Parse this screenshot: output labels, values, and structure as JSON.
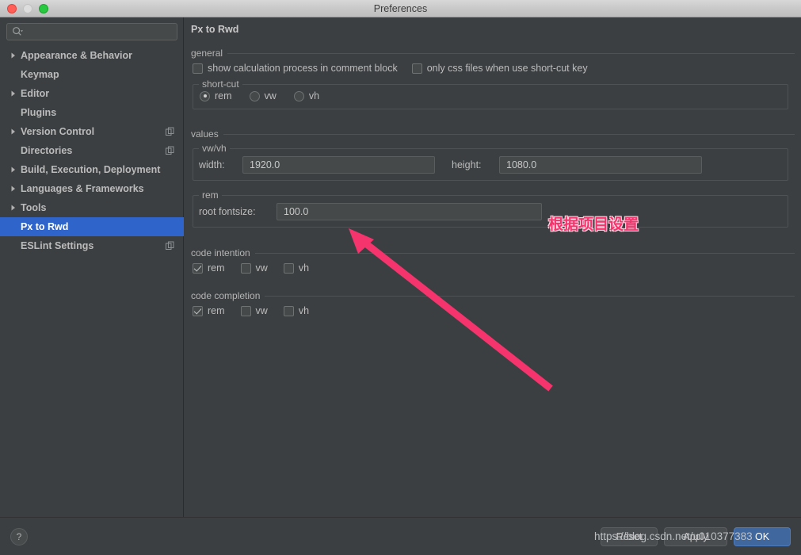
{
  "window": {
    "title": "Preferences",
    "traffic_lights": [
      "close-red",
      "minimize-gray",
      "zoom-green"
    ]
  },
  "sidebar": {
    "search": {
      "value": "",
      "placeholder": ""
    },
    "items": [
      {
        "label": "Appearance & Behavior",
        "expandable": true,
        "selected": false,
        "copy_icon": false
      },
      {
        "label": "Keymap",
        "expandable": false,
        "selected": false,
        "copy_icon": false
      },
      {
        "label": "Editor",
        "expandable": true,
        "selected": false,
        "copy_icon": false
      },
      {
        "label": "Plugins",
        "expandable": false,
        "selected": false,
        "copy_icon": false
      },
      {
        "label": "Version Control",
        "expandable": true,
        "selected": false,
        "copy_icon": true
      },
      {
        "label": "Directories",
        "expandable": false,
        "selected": false,
        "copy_icon": true
      },
      {
        "label": "Build, Execution, Deployment",
        "expandable": true,
        "selected": false,
        "copy_icon": false
      },
      {
        "label": "Languages & Frameworks",
        "expandable": true,
        "selected": false,
        "copy_icon": false
      },
      {
        "label": "Tools",
        "expandable": true,
        "selected": false,
        "copy_icon": false
      },
      {
        "label": "Px to Rwd",
        "expandable": false,
        "selected": true,
        "copy_icon": false
      },
      {
        "label": "ESLint Settings",
        "expandable": false,
        "selected": false,
        "copy_icon": true
      }
    ]
  },
  "main": {
    "page_title": "Px to Rwd",
    "general": {
      "group_label": "general",
      "checkboxes": [
        {
          "label": "show calculation process in comment block",
          "checked": false
        },
        {
          "label": "only css files when use short-cut key",
          "checked": false
        }
      ],
      "shortcut": {
        "legend": "short-cut",
        "options": [
          {
            "label": "rem",
            "selected": true
          },
          {
            "label": "vw",
            "selected": false
          },
          {
            "label": "vh",
            "selected": false
          }
        ]
      }
    },
    "values": {
      "group_label": "values",
      "vwvh": {
        "legend": "vw/vh",
        "width_label": "width:",
        "width_value": "1920.0",
        "height_label": "height:",
        "height_value": "1080.0"
      },
      "rem": {
        "legend": "rem",
        "root_fontsize_label": "root fontsize:",
        "root_fontsize_value": "100.0"
      }
    },
    "code_intention": {
      "group_label": "code intention",
      "checkboxes": [
        {
          "label": "rem",
          "checked": true
        },
        {
          "label": "vw",
          "checked": false
        },
        {
          "label": "vh",
          "checked": false
        }
      ]
    },
    "code_completion": {
      "group_label": "code completion",
      "checkboxes": [
        {
          "label": "rem",
          "checked": true
        },
        {
          "label": "vw",
          "checked": false
        },
        {
          "label": "vh",
          "checked": false
        }
      ]
    }
  },
  "bottom": {
    "help_label": "?",
    "reset_label": "Reset",
    "apply_label": "Apply",
    "ok_label": "OK"
  },
  "annotations": {
    "note_text": "根据项目设置",
    "note_color": "#f5336c",
    "arrow_color": "#f5336c",
    "watermark": "https://blog.csdn.net/u010377383"
  }
}
